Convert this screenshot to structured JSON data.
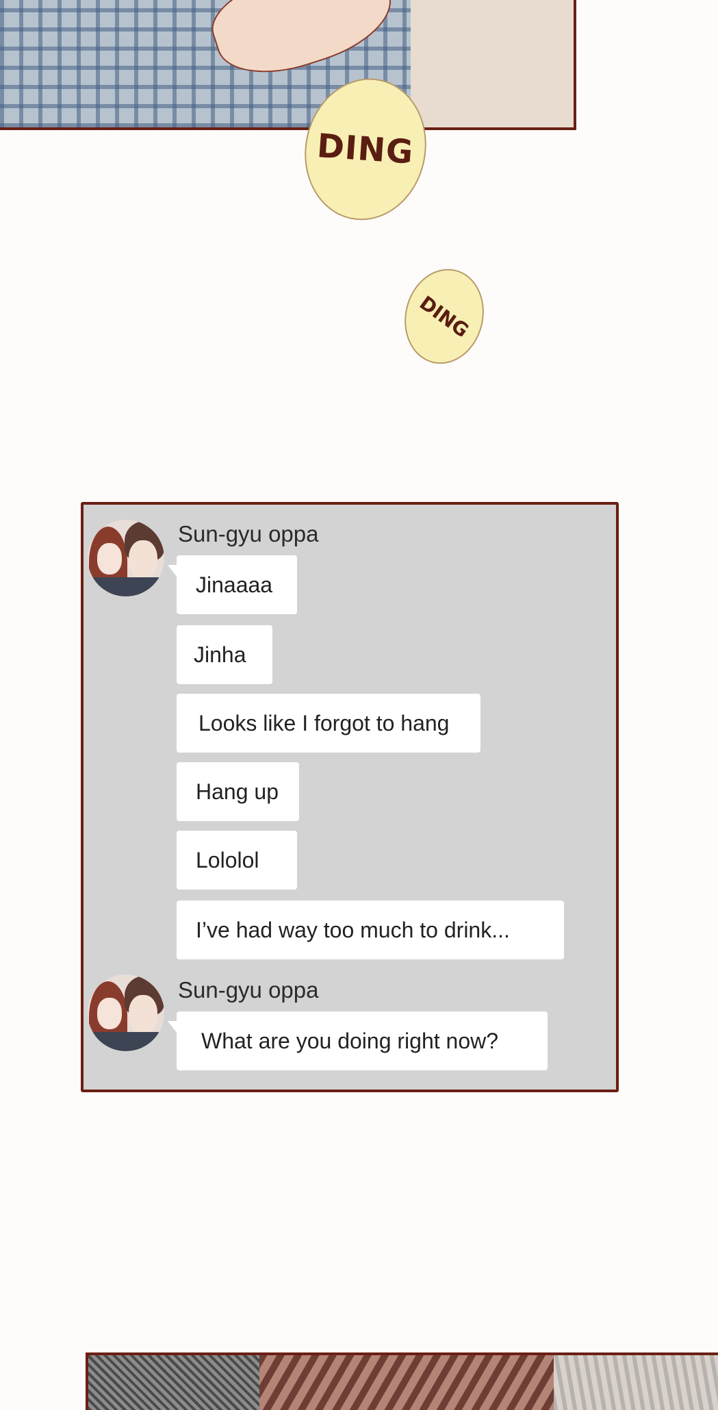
{
  "sound_effects": {
    "ding_large": "DING",
    "ding_small": "DING"
  },
  "chat": {
    "groups": [
      {
        "sender": "Sun-gyu oppa",
        "messages": [
          "Jinaaaa",
          "Jinha",
          "Looks like I forgot to hang",
          "Hang up",
          "Lololol",
          "I’ve had way too much to drink..."
        ]
      },
      {
        "sender": "Sun-gyu oppa",
        "messages": [
          "What are you doing right now?"
        ]
      }
    ]
  },
  "colors": {
    "panel_border": "#6b1f14",
    "chat_background": "#d3d3d3",
    "bubble": "#ffffff",
    "ding_fill": "#f8efb4"
  }
}
